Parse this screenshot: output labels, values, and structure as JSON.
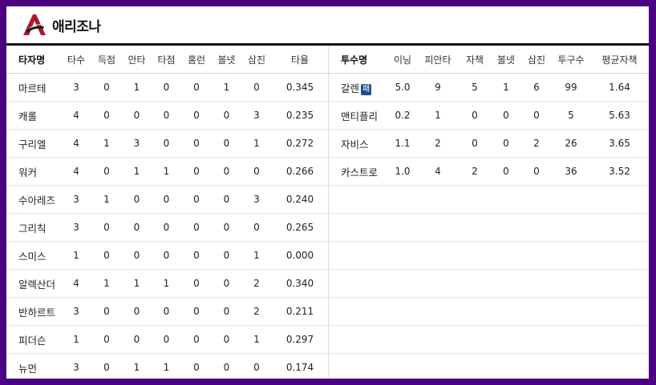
{
  "team": {
    "name": "애리조나",
    "logo_icon": "arizona-a-logo-icon",
    "brand_color": "#a71930"
  },
  "batters": {
    "headers": [
      "타자명",
      "타수",
      "득점",
      "안타",
      "타점",
      "홈런",
      "볼넷",
      "삼진",
      "타율"
    ],
    "rows": [
      [
        "마르테",
        "3",
        "0",
        "1",
        "0",
        "0",
        "1",
        "0",
        "0.345"
      ],
      [
        "캐롤",
        "4",
        "0",
        "0",
        "0",
        "0",
        "0",
        "3",
        "0.235"
      ],
      [
        "구리엘",
        "4",
        "1",
        "3",
        "0",
        "0",
        "0",
        "1",
        "0.272"
      ],
      [
        "워커",
        "4",
        "0",
        "1",
        "1",
        "0",
        "0",
        "0",
        "0.266"
      ],
      [
        "수아레즈",
        "3",
        "1",
        "0",
        "0",
        "0",
        "0",
        "3",
        "0.240"
      ],
      [
        "그리칙",
        "3",
        "0",
        "0",
        "0",
        "0",
        "0",
        "0",
        "0.265"
      ],
      [
        "스미스",
        "1",
        "0",
        "0",
        "0",
        "0",
        "0",
        "1",
        "0.000"
      ],
      [
        "알렉산더",
        "4",
        "1",
        "1",
        "1",
        "0",
        "0",
        "2",
        "0.340"
      ],
      [
        "반하르트",
        "3",
        "0",
        "0",
        "0",
        "0",
        "0",
        "2",
        "0.211"
      ],
      [
        "피더슨",
        "1",
        "0",
        "0",
        "0",
        "0",
        "0",
        "1",
        "0.297"
      ],
      [
        "뉴먼",
        "3",
        "0",
        "1",
        "1",
        "0",
        "0",
        "0",
        "0.174"
      ]
    ]
  },
  "pitchers": {
    "headers": [
      "투수명",
      "이닝",
      "피안타",
      "자책",
      "볼넷",
      "삼진",
      "투구수",
      "평균자책"
    ],
    "rows": [
      {
        "name": "갈렌",
        "badge": "패",
        "values": [
          "5.0",
          "9",
          "5",
          "1",
          "6",
          "99",
          "1.64"
        ]
      },
      {
        "name": "맨티플리",
        "badge": "",
        "values": [
          "0.2",
          "1",
          "0",
          "0",
          "0",
          "5",
          "5.63"
        ]
      },
      {
        "name": "자비스",
        "badge": "",
        "values": [
          "1.1",
          "2",
          "0",
          "0",
          "2",
          "26",
          "3.65"
        ]
      },
      {
        "name": "카스트로",
        "badge": "",
        "values": [
          "1.0",
          "4",
          "2",
          "0",
          "0",
          "36",
          "3.52"
        ]
      }
    ],
    "empty_rows": 7,
    "badge_color": "#1f4b8c"
  }
}
